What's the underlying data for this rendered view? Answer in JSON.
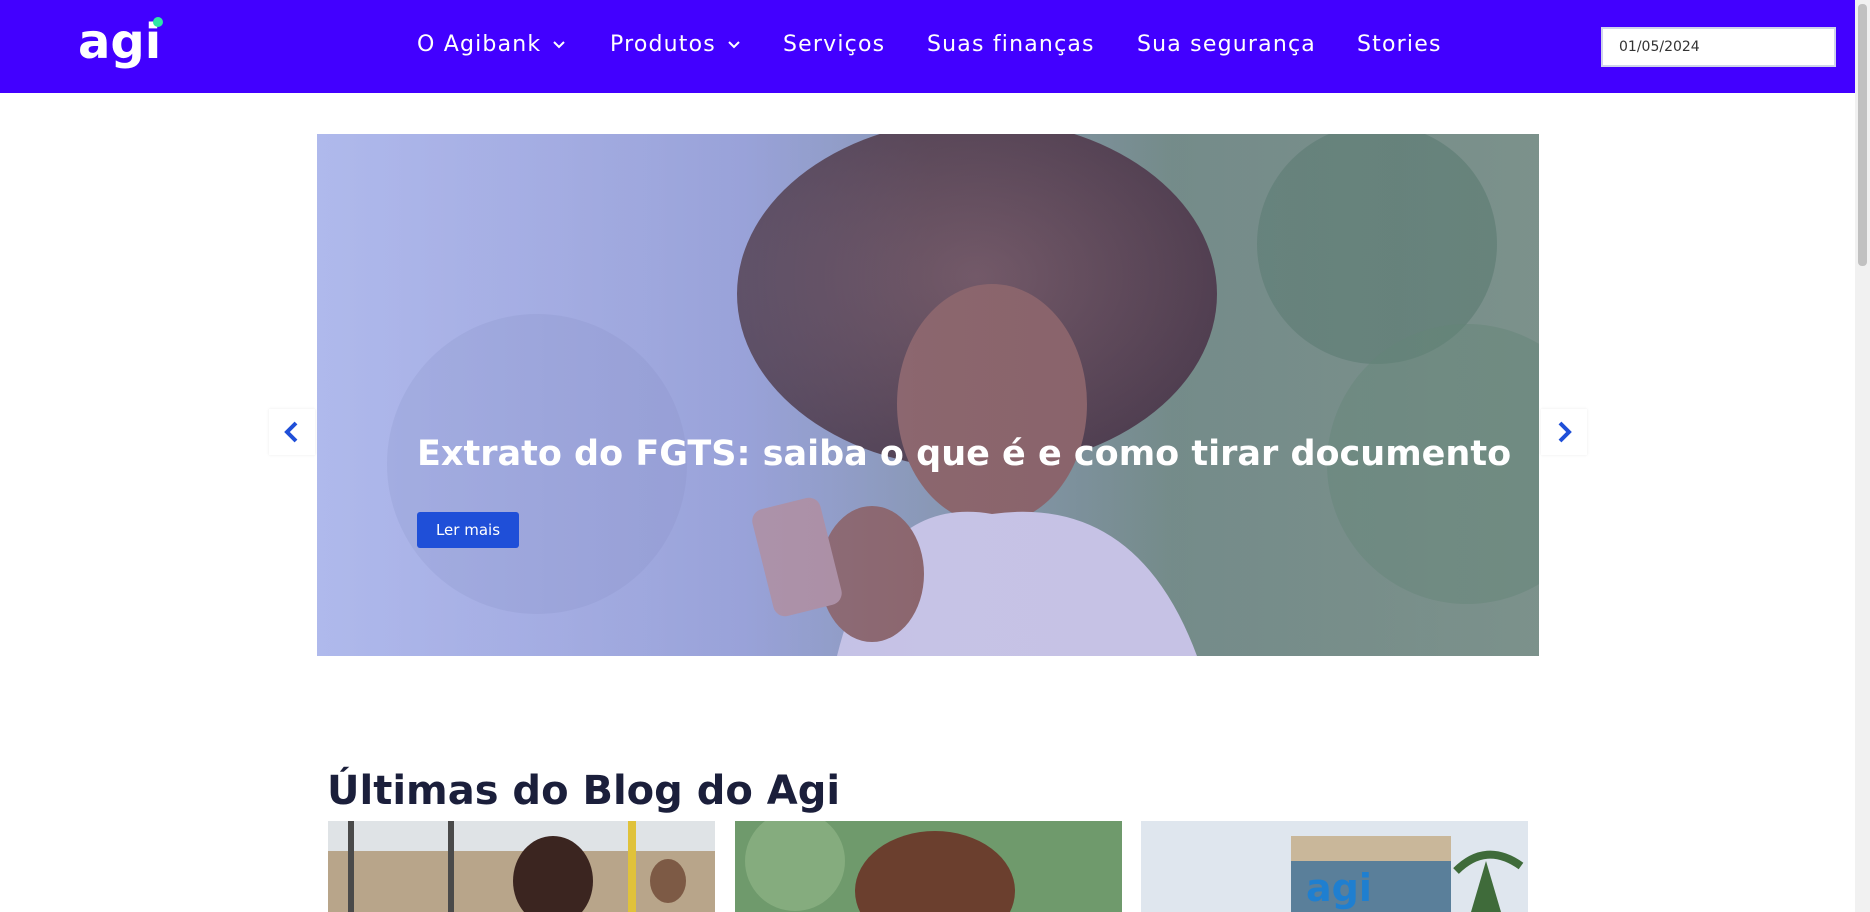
{
  "brand": {
    "logo_text": "agi",
    "colors": {
      "header_bg": "#4200ff",
      "logo_dot": "#2ee6a6",
      "button_bg": "#1f4fd8",
      "arrow": "#1f4fd8",
      "heading": "#1b1f3b"
    }
  },
  "nav": {
    "items": [
      {
        "label": "O Agibank",
        "has_dropdown": true
      },
      {
        "label": "Produtos",
        "has_dropdown": true
      },
      {
        "label": "Serviços",
        "has_dropdown": false
      },
      {
        "label": "Suas finanças",
        "has_dropdown": false
      },
      {
        "label": "Sua segurança",
        "has_dropdown": false
      },
      {
        "label": "Stories",
        "has_dropdown": false
      }
    ],
    "date_value": "01/05/2024"
  },
  "hero": {
    "title": "Extrato do FGTS: saiba o que é e como tirar documento",
    "button_label": "Ler mais",
    "prev_icon": "chevron-left-icon",
    "next_icon": "chevron-right-icon"
  },
  "blog": {
    "title": "Últimas do Blog do Agi",
    "cards": [
      {
        "image": "woman-on-bus-photo"
      },
      {
        "image": "woman-with-curly-hair-photo"
      },
      {
        "image": "agi-building-photo"
      }
    ]
  }
}
